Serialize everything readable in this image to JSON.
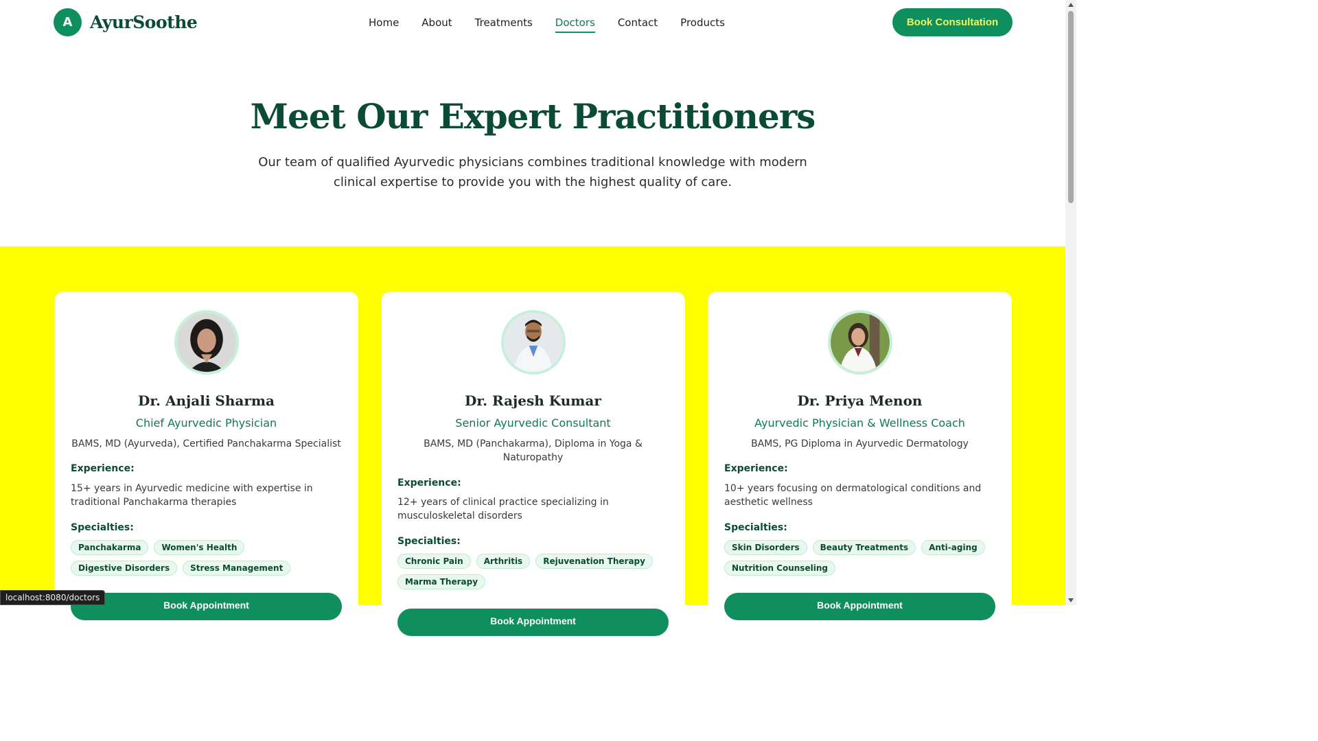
{
  "brand": {
    "logo_letter": "A",
    "name": "AyurSoothe"
  },
  "nav": {
    "items": [
      {
        "label": "Home",
        "active": false
      },
      {
        "label": "About",
        "active": false
      },
      {
        "label": "Treatments",
        "active": false
      },
      {
        "label": "Doctors",
        "active": true
      },
      {
        "label": "Contact",
        "active": false
      },
      {
        "label": "Products",
        "active": false
      }
    ],
    "cta_label": "Book Consultation"
  },
  "hero": {
    "title": "Meet Our Expert Practitioners",
    "subtitle": "Our team of qualified Ayurvedic physicians combines traditional knowledge with modern clinical expertise to provide you with the highest quality of care."
  },
  "doctors": [
    {
      "name": "Dr. Anjali Sharma",
      "role": "Chief Ayurvedic Physician",
      "qualifications": "BAMS, MD (Ayurveda), Certified Panchakarma Specialist",
      "experience_label": "Experience:",
      "experience": "15+ years in Ayurvedic medicine with expertise in traditional Panchakarma therapies",
      "specialties_label": "Specialties:",
      "specialties": [
        "Panchakarma",
        "Women's Health",
        "Digestive Disorders",
        "Stress Management"
      ],
      "button": "Book Appointment"
    },
    {
      "name": "Dr. Rajesh Kumar",
      "role": "Senior Ayurvedic Consultant",
      "qualifications": "BAMS, MD (Panchakarma), Diploma in Yoga & Naturopathy",
      "experience_label": "Experience:",
      "experience": "12+ years of clinical practice specializing in musculoskeletal disorders",
      "specialties_label": "Specialties:",
      "specialties": [
        "Chronic Pain",
        "Arthritis",
        "Rejuvenation Therapy",
        "Marma Therapy"
      ],
      "button": "Book Appointment"
    },
    {
      "name": "Dr. Priya Menon",
      "role": "Ayurvedic Physician & Wellness Coach",
      "qualifications": "BAMS, PG Diploma in Ayurvedic Dermatology",
      "experience_label": "Experience:",
      "experience": "10+ years focusing on dermatological conditions and aesthetic wellness",
      "specialties_label": "Specialties:",
      "specialties": [
        "Skin Disorders",
        "Beauty Treatments",
        "Anti-aging",
        "Nutrition Counseling"
      ],
      "button": "Book Appointment"
    }
  ],
  "status_bar": {
    "url": "localhost:8080/doctors"
  },
  "colors": {
    "brand_green": "#0f8f5e",
    "dark_green": "#0b4a36",
    "band_yellow": "#ffff00",
    "cta_text": "#f2f65a"
  }
}
